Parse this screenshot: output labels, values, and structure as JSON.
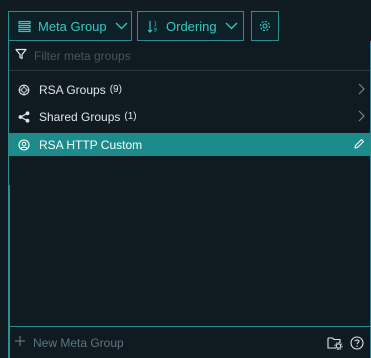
{
  "toolbar": {
    "meta_group_label": "Meta Group",
    "ordering_label": "Ordering"
  },
  "filter": {
    "placeholder": "Filter meta groups"
  },
  "list": {
    "items": [
      {
        "label": "RSA Groups",
        "count": "(9)",
        "icon": "rsa-groups-icon",
        "trailing": "chevron-right-icon",
        "selected": false
      },
      {
        "label": "Shared Groups",
        "count": "(1)",
        "icon": "share-icon",
        "trailing": "chevron-right-icon",
        "selected": false
      },
      {
        "label": "RSA HTTP Custom",
        "count": "",
        "icon": "user-circle-icon",
        "trailing": "edit-pencil-icon",
        "selected": true
      }
    ]
  },
  "footer": {
    "new_label": "New Meta Group"
  },
  "colors": {
    "background": "#101c22",
    "accent": "#34c9c2",
    "border": "#2e8e8f",
    "selected_row": "#1b8b8b",
    "muted_text": "#5e7580"
  }
}
